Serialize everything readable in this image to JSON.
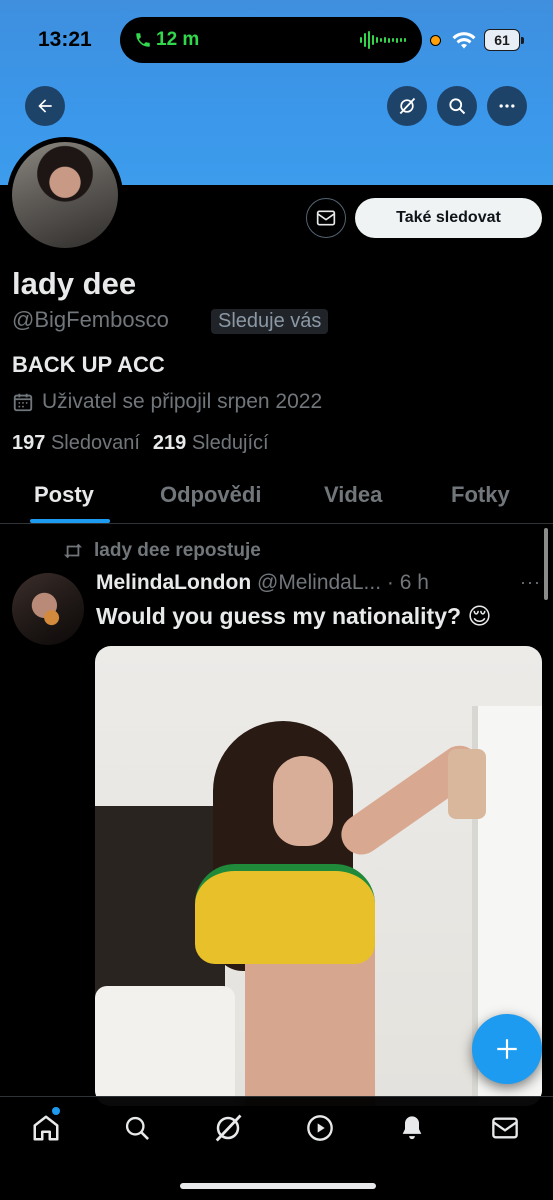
{
  "status_bar": {
    "time": "13:21",
    "call_duration": "12 m",
    "battery": "61"
  },
  "header": {
    "back_icon": "arrow-left-icon",
    "grok_icon": "grok-icon",
    "search_icon": "search-icon",
    "more_icon": "more-icon"
  },
  "profile": {
    "name": "lady dee",
    "handle": "@BigFembosco",
    "follows_you": "Sleduje vás",
    "bio": "BACK UP ACC",
    "joined": "Uživatel se připojil srpen 2022",
    "following_count": "197",
    "following_label": "Sledovaní",
    "followers_count": "219",
    "followers_label": "Sledující",
    "follow_button": "Také sledovat"
  },
  "tabs": [
    {
      "label": "Posty",
      "active": true
    },
    {
      "label": "Odpovědi",
      "active": false
    },
    {
      "label": "Videa",
      "active": false
    },
    {
      "label": "Fotky",
      "active": false
    }
  ],
  "post": {
    "repost_label": "lady dee repostuje",
    "author": "MelindaLondon",
    "handle": "@MelindaL...",
    "time": "· 6 h",
    "more": "···",
    "text": "Would you guess my nationality? 😌"
  },
  "bottom_nav": {
    "items": [
      "home-icon",
      "search-icon",
      "grok-icon",
      "video-icon",
      "notifications-icon",
      "messages-icon"
    ]
  },
  "colors": {
    "accent": "#1d9bf0",
    "banner": "#3d96e8",
    "background": "#000000",
    "muted_text": "#71767b"
  }
}
